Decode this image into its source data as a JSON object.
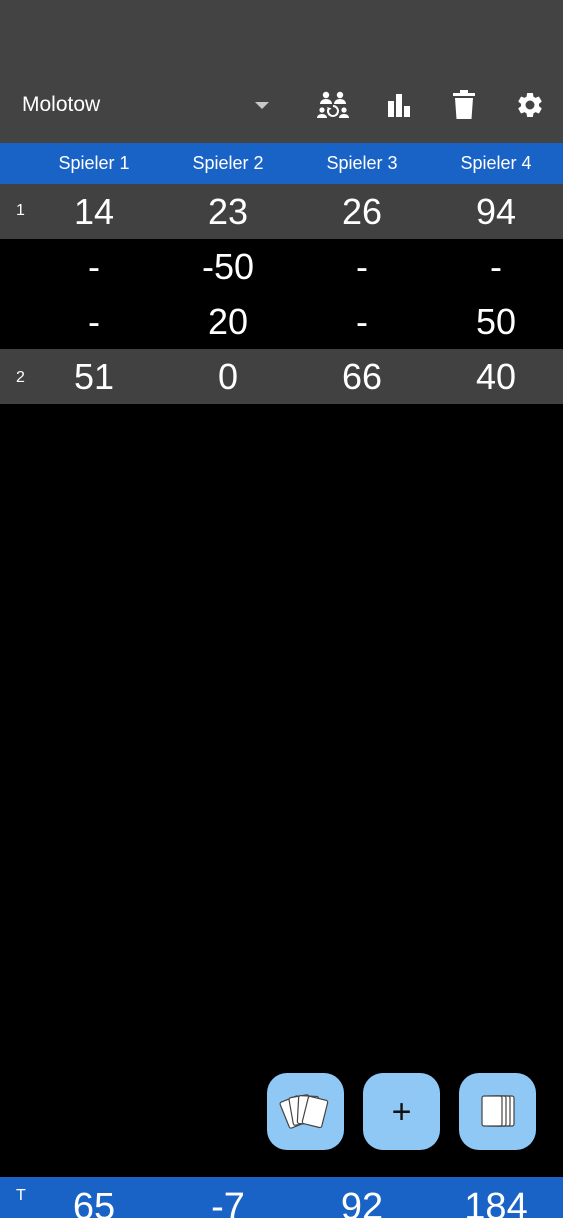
{
  "appbar": {
    "game_name": "Molotow",
    "actions": [
      {
        "icon": "players-swap-icon"
      },
      {
        "icon": "bar-chart-icon"
      },
      {
        "icon": "trash-icon"
      },
      {
        "icon": "gear-icon"
      }
    ]
  },
  "players": [
    "Spieler 1",
    "Spieler 2",
    "Spieler 3",
    "Spieler 4"
  ],
  "rounds": [
    {
      "number": "1",
      "scores": [
        "14",
        "23",
        "26",
        "94"
      ],
      "details": [
        [
          "-",
          "-50",
          "-",
          "-"
        ],
        [
          "-",
          "20",
          "-",
          "50"
        ]
      ]
    },
    {
      "number": "2",
      "scores": [
        "51",
        "0",
        "66",
        "40"
      ],
      "details": []
    }
  ],
  "fabs": {
    "left_icon": "card-fan-icon",
    "add_label": "+",
    "right_icon": "card-stack-icon"
  },
  "totals": {
    "label": "T",
    "values": [
      "65",
      "-7",
      "92",
      "184"
    ]
  },
  "colors": {
    "appbar": "#434343",
    "header": "#1a63c6",
    "round_row": "#414141",
    "fab": "#90c8f5"
  }
}
